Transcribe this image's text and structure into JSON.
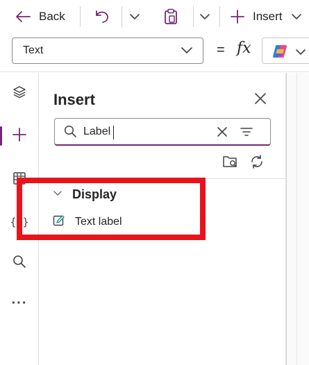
{
  "toolbar": {
    "back_label": "Back",
    "undo_icon": "undo-icon",
    "paste_icon": "clipboard-icon",
    "insert_label": "Insert"
  },
  "formula_bar": {
    "property_value": "Text",
    "equals": "=",
    "fx": "fx",
    "copilot_icon": "copilot-icon"
  },
  "left_rail": {
    "items": [
      {
        "icon": "layers-icon",
        "active": false
      },
      {
        "icon": "plus-icon",
        "active": true
      },
      {
        "icon": "data-table-icon",
        "active": false
      },
      {
        "icon": "variables-icon",
        "glyph": "{x}",
        "active": false
      },
      {
        "icon": "search-icon",
        "active": false
      },
      {
        "icon": "more-icon",
        "glyph": "···",
        "active": false
      }
    ]
  },
  "insert_pane": {
    "title": "Insert",
    "search": {
      "value": "Label"
    },
    "groups": [
      {
        "label": "Display",
        "expanded": true,
        "items": [
          {
            "label": "Text label",
            "icon": "edit-text-icon"
          }
        ]
      }
    ]
  },
  "annotation": {
    "color": "#e8141c"
  },
  "colors": {
    "accent": "#742774",
    "icon": "#424242",
    "text": "#242424"
  }
}
